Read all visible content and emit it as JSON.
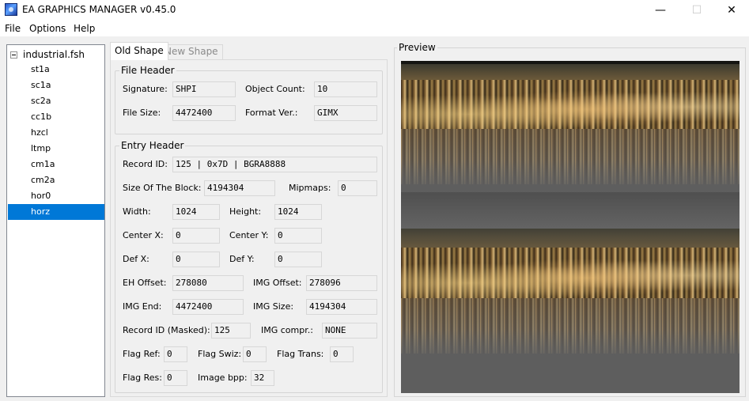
{
  "window": {
    "title": "EA GRAPHICS MANAGER v0.45.0",
    "minimize": "—",
    "maximize": "☐",
    "close": "✕"
  },
  "menu": [
    "File",
    "Options",
    "Help"
  ],
  "tree": {
    "root": "industrial.fsh",
    "items": [
      "st1a",
      "sc1a",
      "sc2a",
      "cc1b",
      "hzcl",
      "ltmp",
      "cm1a",
      "cm2a",
      "hor0",
      "horz"
    ],
    "selected": "horz"
  },
  "tabs": {
    "old": "Old Shape",
    "new": "New Shape"
  },
  "file_header": {
    "title": "File Header",
    "signature_label": "Signature:",
    "signature": "SHPI",
    "object_count_label": "Object Count:",
    "object_count": "10",
    "file_size_label": "File Size:",
    "file_size": "4472400",
    "format_ver_label": "Format Ver.:",
    "format_ver": "GIMX"
  },
  "entry_header": {
    "title": "Entry Header",
    "record_id_label": "Record ID:",
    "record_id": "125 | 0x7D | BGRA8888",
    "block_size_label": "Size Of The Block:",
    "block_size": "4194304",
    "mipmaps_label": "Mipmaps:",
    "mipmaps": "0",
    "width_label": "Width:",
    "width": "1024",
    "height_label": "Height:",
    "height": "1024",
    "center_x_label": "Center X:",
    "center_x": "0",
    "center_y_label": "Center Y:",
    "center_y": "0",
    "def_x_label": "Def X:",
    "def_x": "0",
    "def_y_label": "Def Y:",
    "def_y": "0",
    "eh_offset_label": "EH Offset:",
    "eh_offset": "278080",
    "img_offset_label": "IMG Offset:",
    "img_offset": "278096",
    "img_end_label": "IMG End:",
    "img_end": "4472400",
    "img_size_label": "IMG Size:",
    "img_size": "4194304",
    "record_id_masked_label": "Record ID (Masked):",
    "record_id_masked": "125",
    "img_compr_label": "IMG compr.:",
    "img_compr": "NONE",
    "flag_ref_label": "Flag Ref:",
    "flag_ref": "0",
    "flag_swiz_label": "Flag Swiz:",
    "flag_swiz": "0",
    "flag_trans_label": "Flag Trans:",
    "flag_trans": "0",
    "flag_res_label": "Flag Res:",
    "flag_res": "0",
    "image_bpp_label": "Image bpp:",
    "image_bpp": "32"
  },
  "preview": {
    "title": "Preview"
  },
  "colors": {
    "selection": "#0078d7",
    "window_bg": "#f0f0f0",
    "preview_bg": "#5e5e5e"
  }
}
